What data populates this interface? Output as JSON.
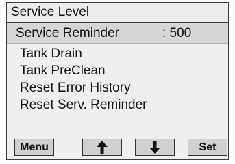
{
  "header": {
    "title": "Service Level"
  },
  "selected_item": {
    "label": "Service Reminder",
    "value": ": 500"
  },
  "menu": {
    "items": [
      "Tank Drain",
      "Tank PreClean",
      "Reset Error History",
      "Reset Serv. Reminder"
    ]
  },
  "buttons": {
    "menu_label": "Menu",
    "up_icon": "arrow-up-icon",
    "down_icon": "arrow-down-icon",
    "set_label": "Set"
  }
}
